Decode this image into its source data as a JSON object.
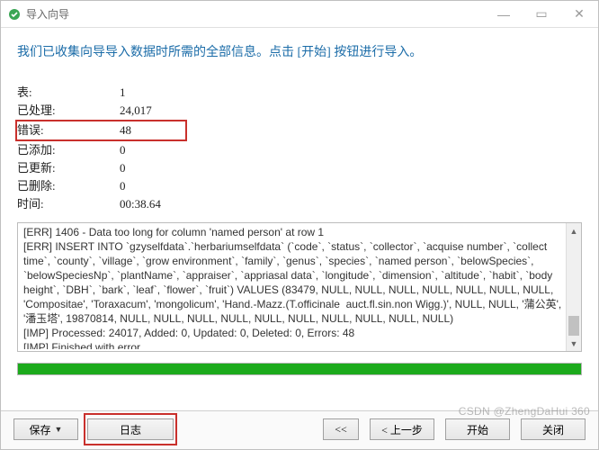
{
  "window": {
    "title": "导入向导",
    "min_icon": "—",
    "max_icon": "▭",
    "close_icon": "✕"
  },
  "intro": "我们已收集向导导入数据时所需的全部信息。点击 [开始] 按钮进行导入。",
  "stats": {
    "table_label": "表:",
    "table_value": "1",
    "processed_label": "已处理:",
    "processed_value": "24,017",
    "errors_label": "错误:",
    "errors_value": "48",
    "added_label": "已添加:",
    "added_value": "0",
    "updated_label": "已更新:",
    "updated_value": "0",
    "deleted_label": "已删除:",
    "deleted_value": "0",
    "time_label": "时间:",
    "time_value": "00:38.64"
  },
  "log": {
    "lines": "[ERR] 1406 - Data too long for column 'named person' at row 1\n[ERR] INSERT INTO `gzyselfdata`.`herbariumselfdata` (`code`, `status`, `collector`, `acquise number`, `collect time`, `county`, `village`, `grow environment`, `family`, `genus`, `species`, `named person`, `belowSpecies`, `belowSpeciesNp`, `plantName`, `appraiser`, `appriasal data`, `longitude`, `dimension`, `altitude`, `habit`, `body height`, `DBH`, `bark`, `leaf`, `flower`, `fruit`) VALUES (83479, NULL, NULL, NULL, NULL, NULL, NULL, NULL, 'Compositae', 'Toraxacum', 'mongolicum', 'Hand.-Mazz.(T.officinale  auct.fl.sin.non Wigg.)', NULL, NULL, '蒲公英', '潘玉塔', 19870814, NULL, NULL, NULL, NULL, NULL, NULL, NULL, NULL, NULL, NULL)\n[IMP] Processed: 24017, Added: 0, Updated: 0, Deleted: 0, Errors: 48\n[IMP] Finished with error"
  },
  "buttons": {
    "save": "保存",
    "log": "日志",
    "first": "<<",
    "prev": "< 上一步",
    "start": "开始",
    "close": "关闭"
  },
  "watermark": "CSDN @ZhengDaHui 360"
}
